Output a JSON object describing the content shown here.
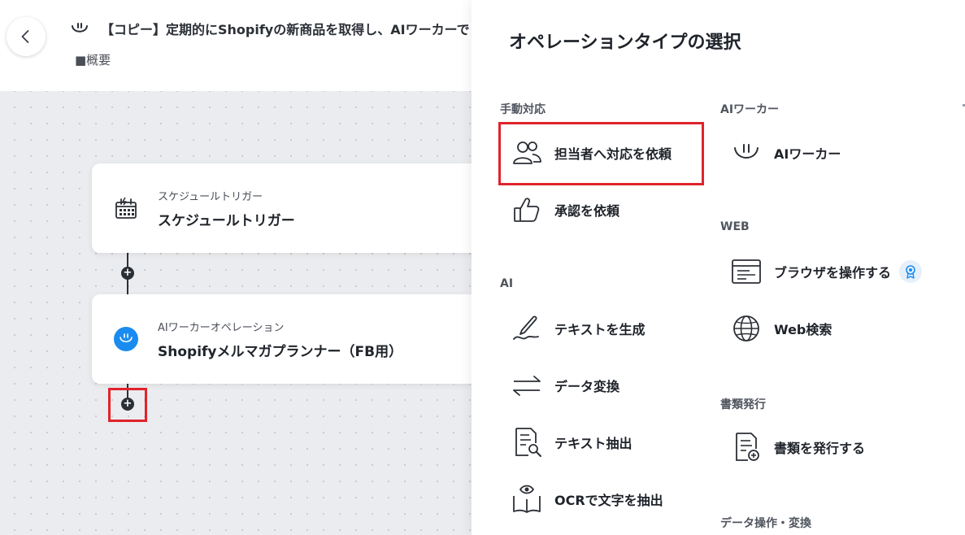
{
  "header": {
    "title": "【コピー】定期的にShopifyの新商品を取得し、AIワーカーで",
    "summary": "■概要",
    "back_icon": "chevron-left-icon",
    "flow_icon": "smile-icon"
  },
  "flow": {
    "trigger": {
      "subtitle": "スケジュールトリガー",
      "title": "スケジュールトリガー",
      "icon": "calendar-schedule-icon"
    },
    "operation": {
      "subtitle": "AIワーカーオペレーション",
      "title": "Shopifyメルマガプランナー（FB用）",
      "icon": "ai-worker-icon"
    },
    "add_symbol": "+"
  },
  "panel": {
    "title": "オペレーションタイプの選択",
    "sections": {
      "manual": {
        "label": "手動対応",
        "items": [
          {
            "label": "担当者へ対応を依頼",
            "icon": "people-icon"
          },
          {
            "label": "承認を依頼",
            "icon": "thumbs-up-icon"
          }
        ]
      },
      "ai": {
        "label": "AI",
        "items": [
          {
            "label": "テキストを生成",
            "icon": "pen-icon"
          },
          {
            "label": "データ変換",
            "icon": "swap-arrows-icon"
          },
          {
            "label": "テキスト抽出",
            "icon": "document-search-icon"
          },
          {
            "label": "OCRで文字を抽出",
            "icon": "book-eye-icon"
          }
        ]
      },
      "aiworker": {
        "label": "AIワーカー",
        "items": [
          {
            "label": "AIワーカー",
            "icon": "ai-worker-icon"
          }
        ]
      },
      "web": {
        "label": "WEB",
        "items": [
          {
            "label": "ブラウザを操作する",
            "icon": "browser-icon",
            "badge": "award-icon"
          },
          {
            "label": "Web検索",
            "icon": "globe-icon"
          }
        ]
      },
      "docs": {
        "label": "書類発行",
        "items": [
          {
            "label": "書類を発行する",
            "icon": "document-add-icon"
          }
        ]
      },
      "data": {
        "label": "データ操作・変換"
      }
    }
  },
  "colors": {
    "highlight": "#e0232c",
    "ai_blue": "#1a8cf0",
    "text": "#1f232a"
  }
}
